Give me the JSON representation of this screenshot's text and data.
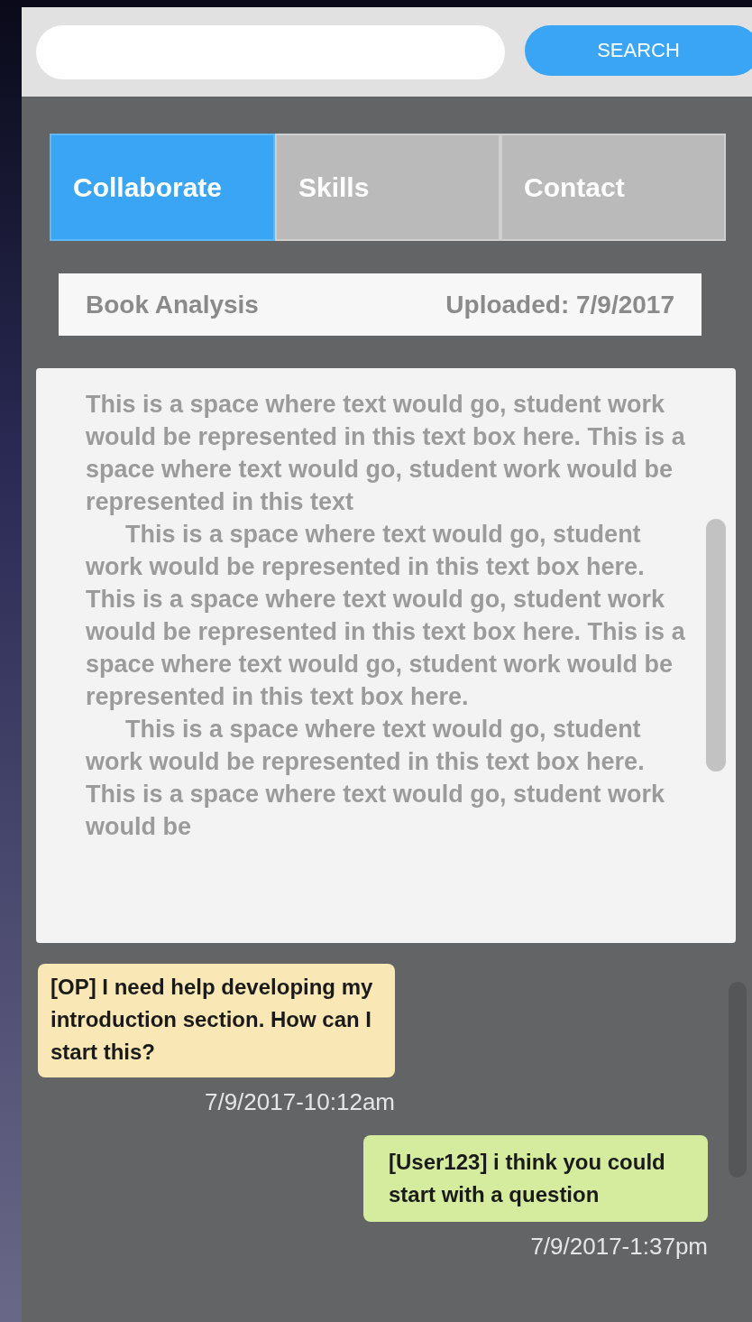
{
  "search": {
    "button": "SEARCH"
  },
  "tabs": [
    {
      "label": "Collaborate",
      "selected": true
    },
    {
      "label": "Skills",
      "selected": false
    },
    {
      "label": "Contact",
      "selected": false
    }
  ],
  "document": {
    "title": "Book Analysis",
    "uploaded": "Uploaded: 7/9/2017",
    "paragraphs": [
      "This is a space where text would go, student work would be represented in this text box here. This is a space where text would go, student work would be represented in this text",
      "This is a space where text would go, student work would be represented in this text box here. This is a space where text would go, student work would be represented in this text box here. This is a space where text would go, student work would be represented in this text box here.",
      "This is a space where text would go, student work would be represented in this text box here. This is a space where text would go, student work would be"
    ]
  },
  "messages": [
    {
      "kind": "incoming",
      "text": "[OP] I need help developing my introduction section. How can I start this?",
      "time": "7/9/2017-10:12am"
    },
    {
      "kind": "outgoing",
      "text": "[User123] i think you could start with a question",
      "time": "7/9/2017-1:37pm"
    }
  ]
}
